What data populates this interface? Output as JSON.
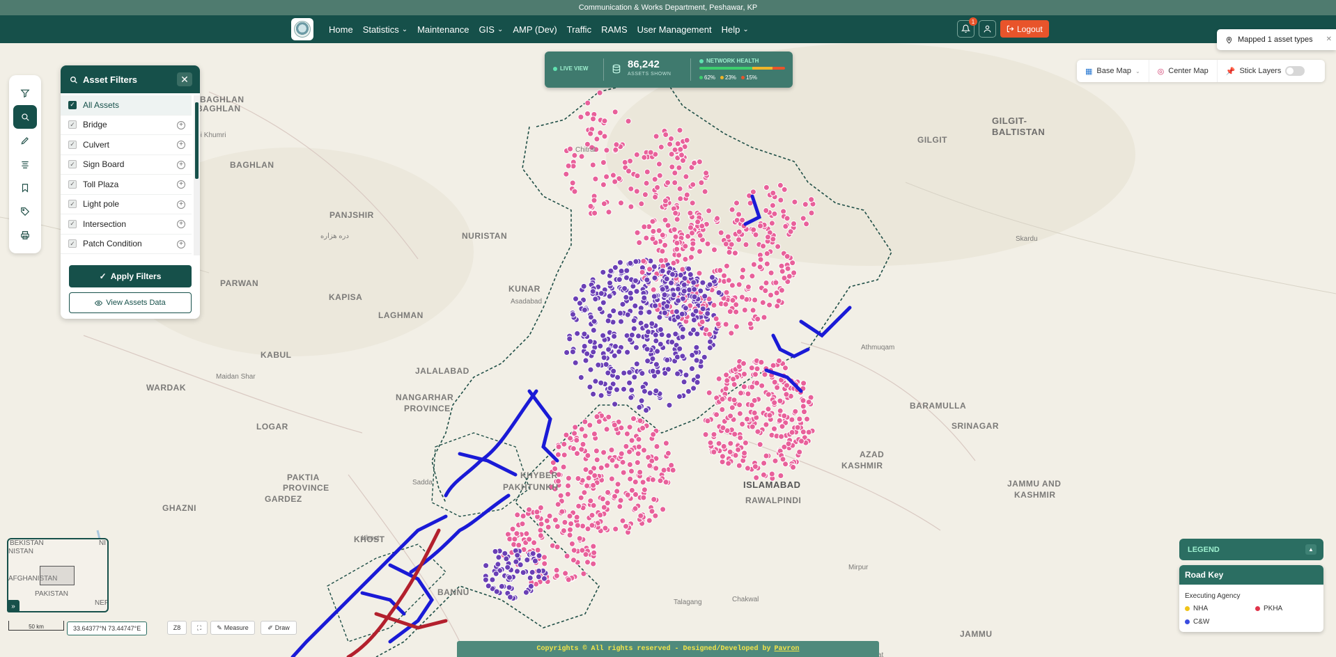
{
  "top_strip": "Communication & Works Department, Peshawar, KP",
  "nav": {
    "links": [
      {
        "label": "Home",
        "dropdown": false
      },
      {
        "label": "Statistics",
        "dropdown": true
      },
      {
        "label": "Maintenance",
        "dropdown": false
      },
      {
        "label": "GIS",
        "dropdown": true
      },
      {
        "label": "AMP (Dev)",
        "dropdown": false
      },
      {
        "label": "Traffic",
        "dropdown": false
      },
      {
        "label": "RAMS",
        "dropdown": false
      },
      {
        "label": "User Management",
        "dropdown": false
      },
      {
        "label": "Help",
        "dropdown": true
      }
    ],
    "notification_count": "1",
    "logout_label": "Logout"
  },
  "toolbar": {
    "tools": [
      "filter-icon",
      "layers-icon",
      "pencil-icon",
      "list-icon",
      "bookmark-icon",
      "tag-icon",
      "print-icon"
    ]
  },
  "filters": {
    "title": "Asset Filters",
    "items": [
      {
        "label": "All Assets",
        "checked": true
      },
      {
        "label": "Bridge",
        "checked": true
      },
      {
        "label": "Culvert",
        "checked": true
      },
      {
        "label": "Sign Board",
        "checked": true
      },
      {
        "label": "Toll Plaza",
        "checked": true
      },
      {
        "label": "Light pole",
        "checked": true
      },
      {
        "label": "Intersection",
        "checked": true
      },
      {
        "label": "Patch Condition",
        "checked": true
      }
    ],
    "apply_label": "Apply Filters",
    "view_label": "View Assets Data"
  },
  "stats": {
    "live_label": "LIVE VIEW",
    "asset_count": "86,242",
    "asset_label": "ASSETS SHOWN",
    "health_title": "NETWORK HEALTH",
    "health": [
      {
        "pct": "62%",
        "value": 62,
        "color": "#3ecf6e"
      },
      {
        "pct": "23%",
        "value": 23,
        "color": "#f0b429"
      },
      {
        "pct": "15%",
        "value": 15,
        "color": "#e8542b"
      }
    ]
  },
  "toast": {
    "text": "Mapped 1 asset types"
  },
  "map_controls": {
    "base_map": "Base Map",
    "center_map": "Center Map",
    "stick_layers": "Stick Layers"
  },
  "map_labels": [
    "BAGHLAN",
    "BAGHLAN",
    "Pul-i Khumri",
    "BAGHLAN",
    "PANJSHIR",
    "دره هزاره",
    "NURISTAN",
    "KUNAR",
    "Asadabad",
    "PARWAN",
    "KAPISA",
    "LAGHMAN",
    "KABUL",
    "Maidan Shar",
    "WARDAK",
    "JALALABAD",
    "NANGARHAR",
    "PROVINCE",
    "LOGAR",
    "PAKTIA",
    "PROVINCE",
    "GARDEZ",
    "Sadda",
    "KHYBER",
    "PAKHTUNKH",
    "KHOST",
    "Khost",
    "GHAZNI",
    "BANNU",
    "GILGIT-",
    "BALTISTAN",
    "GILGIT",
    "Skardu",
    "Athmuqam",
    "BARAMULLA",
    "SRINAGAR",
    "AZAD",
    "KASHMIR",
    "JAMMU AND",
    "KASHMIR",
    "ISLAMABAD",
    "RAWALPINDI",
    "Mirpur",
    "Talagang",
    "Chakwal",
    "JAMMU",
    "Gujrat",
    "Chitral"
  ],
  "legend": {
    "header": "LEGEND",
    "card_title": "Road Key",
    "subtitle": "Executing Agency",
    "items": [
      {
        "label": "NHA",
        "color": "#f0c419"
      },
      {
        "label": "PKHA",
        "color": "#e0344b"
      },
      {
        "label": "C&W",
        "color": "#3b4de0"
      }
    ]
  },
  "minimap": {
    "labels": [
      "BEKISTAN",
      "NISTAN",
      "AFGHANISTAN",
      "PAKISTAN",
      "NI",
      "NEP"
    ]
  },
  "bottom": {
    "scale": "50 km",
    "coords": "33.64377°N 73.44747°E",
    "zoom": "Z8",
    "measure": "Measure",
    "draw": "Draw"
  },
  "footer": {
    "text": "Copyrights © All rights reserved - Designed/Developed by",
    "link": "Pavron"
  },
  "colors": {
    "primary": "#16504a",
    "accent": "#e8542b",
    "pink_marker": "#e8609a",
    "purple_marker": "#6a3fb5",
    "blue_road": "#1a1ad6",
    "red_road": "#b3202d"
  }
}
